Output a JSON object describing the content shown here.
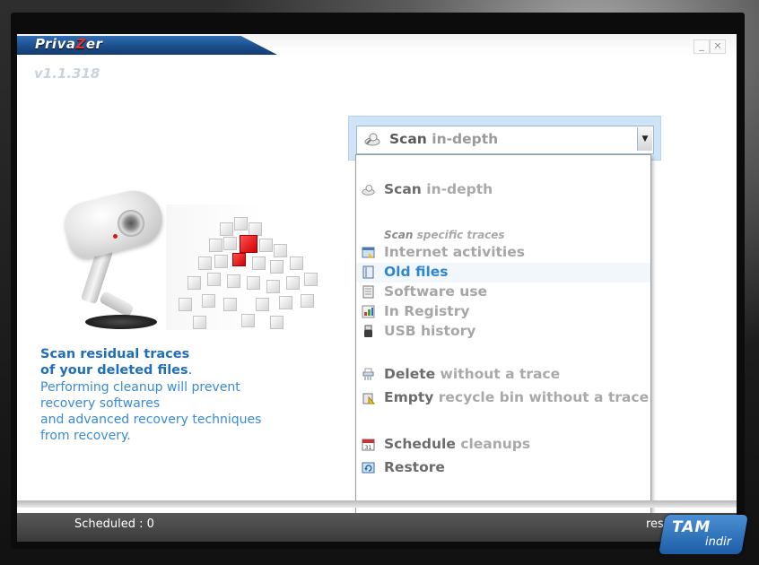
{
  "app": {
    "logo_left": "Priva",
    "logo_z": "Z",
    "logo_right": "er",
    "version": "v1.1.318",
    "minimize_glyph": "_",
    "close_glyph": "×"
  },
  "select": {
    "value_bold": "Scan",
    "value_light": "in-depth",
    "arrow": "▼",
    "icon": "scan-icon"
  },
  "menu": {
    "top_item": {
      "bold": "Scan",
      "light": "in-depth",
      "icon": "scan-icon"
    },
    "section_header": {
      "bold": "Scan",
      "light": "specific traces"
    },
    "specific_items": [
      {
        "label": "Internet activities",
        "icon": "browser-icon"
      },
      {
        "label": "Old files",
        "icon": "file-icon"
      },
      {
        "label": "Software use",
        "icon": "document-icon"
      },
      {
        "label": "In Registry",
        "icon": "registry-icon"
      },
      {
        "label": "USB history",
        "icon": "usb-icon"
      }
    ],
    "delete_item": {
      "bold": "Delete",
      "light": "without a trace",
      "icon": "shredder-icon"
    },
    "recycle_item": {
      "bold": "Empty",
      "light": "recycle bin without a trace",
      "icon": "recycle-bin-icon"
    },
    "schedule_item": {
      "bold": "Schedule",
      "light": "cleanups",
      "icon": "calendar-icon"
    },
    "restore_item": {
      "label": "Restore",
      "icon": "restore-icon"
    }
  },
  "info": {
    "headline_line1": "Scan residual traces",
    "headline_line2": "of your deleted files",
    "headline_period": ".",
    "body": [
      "Performing cleanup will prevent",
      "recovery softwares",
      "and advanced recovery techniques",
      "from recovery."
    ]
  },
  "status": {
    "scheduled": "Scheduled : 0",
    "progress_fragment": "ress"
  },
  "watermark": {
    "main": "TAM",
    "sub": "indir"
  },
  "colors": {
    "accent": "#1f6fbe",
    "hover": "#2f86d2",
    "brand_red": "#e23232"
  }
}
